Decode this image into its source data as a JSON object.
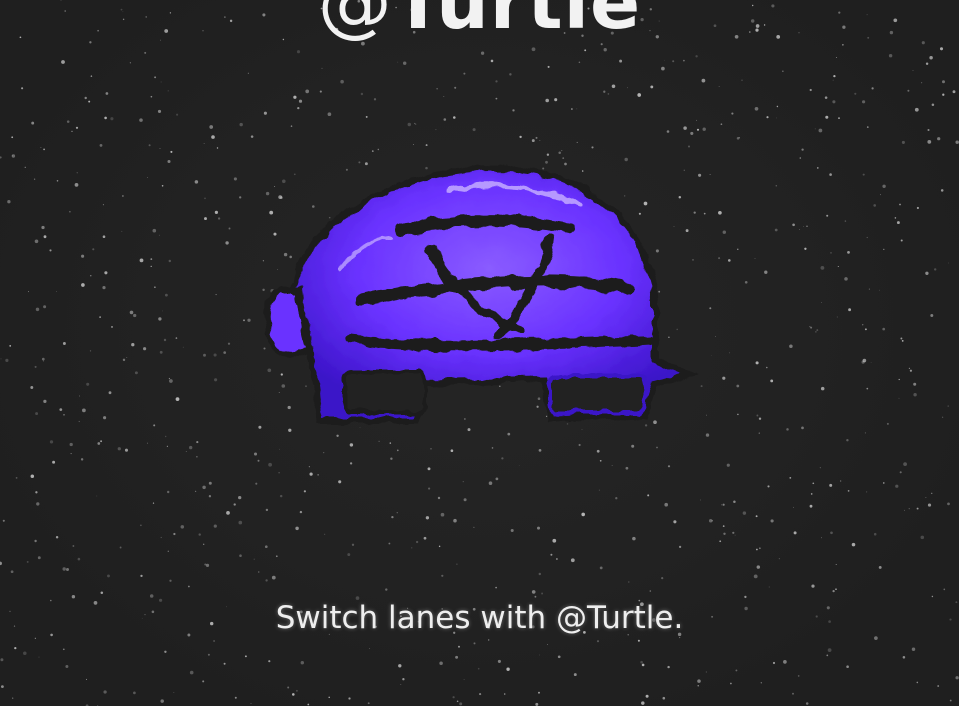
{
  "brand": {
    "at_symbol": "@",
    "name": "Turtle"
  },
  "tagline": "Switch lanes with @Turtle.",
  "logo": {
    "icon": "turtle-icon",
    "colors": {
      "shell_light": "#8a5cff",
      "shell_mid": "#6a32ff",
      "shell_dark": "#3b14c8",
      "shell_highlight": "#c9b3ff",
      "outline": "#1c1c1c"
    }
  },
  "colors": {
    "background": "#232323",
    "text": "#f2f2f2",
    "speckle": "#d9d9d9"
  }
}
